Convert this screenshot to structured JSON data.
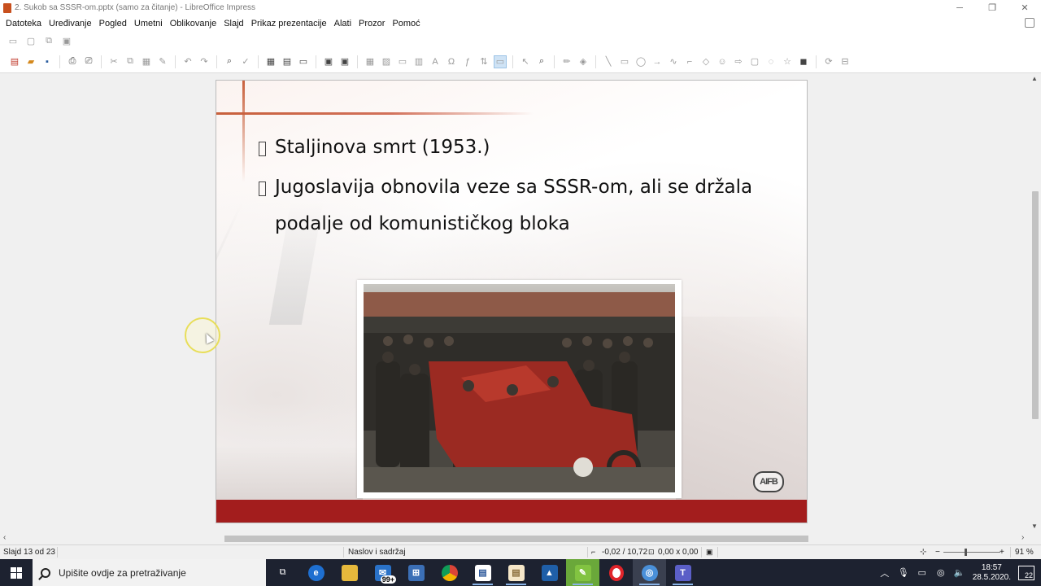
{
  "window": {
    "title": "2. Sukob sa SSSR-om.pptx (samo za čitanje) - LibreOffice Impress",
    "controls": [
      "─",
      "❐",
      "✕"
    ]
  },
  "menu": [
    "Datoteka",
    "Uređivanje",
    "Pogled",
    "Umetni",
    "Oblikovanje",
    "Slajd",
    "Prikaz prezentacije",
    "Alati",
    "Prozor",
    "Pomoć"
  ],
  "slide": {
    "bullets": [
      "Staljinova smrt (1953.)",
      "Jugoslavija obnovila veze sa SSSR-om, ali se držala podalje od komunističkog bloka"
    ],
    "logo_text": "AIFB"
  },
  "statusbar": {
    "slide_info": "Slajd 13 od 23",
    "layout": "Naslov i sadržaj",
    "position": "-0,02 / 10,72",
    "size": "0,00 x 0,00",
    "zoom_minus": "−",
    "zoom_plus": "+",
    "zoom": "91 %"
  },
  "taskbar": {
    "search_placeholder": "Upišite ovdje za pretraživanje",
    "mail_badge": "99+",
    "clock_time": "18:57",
    "clock_date": "28.5.2020.",
    "notification_count": "22"
  },
  "colors": {
    "slide_footer": "#a31d1d",
    "slide_accent_line": "#c8603c",
    "taskbar": "#1d2230"
  }
}
